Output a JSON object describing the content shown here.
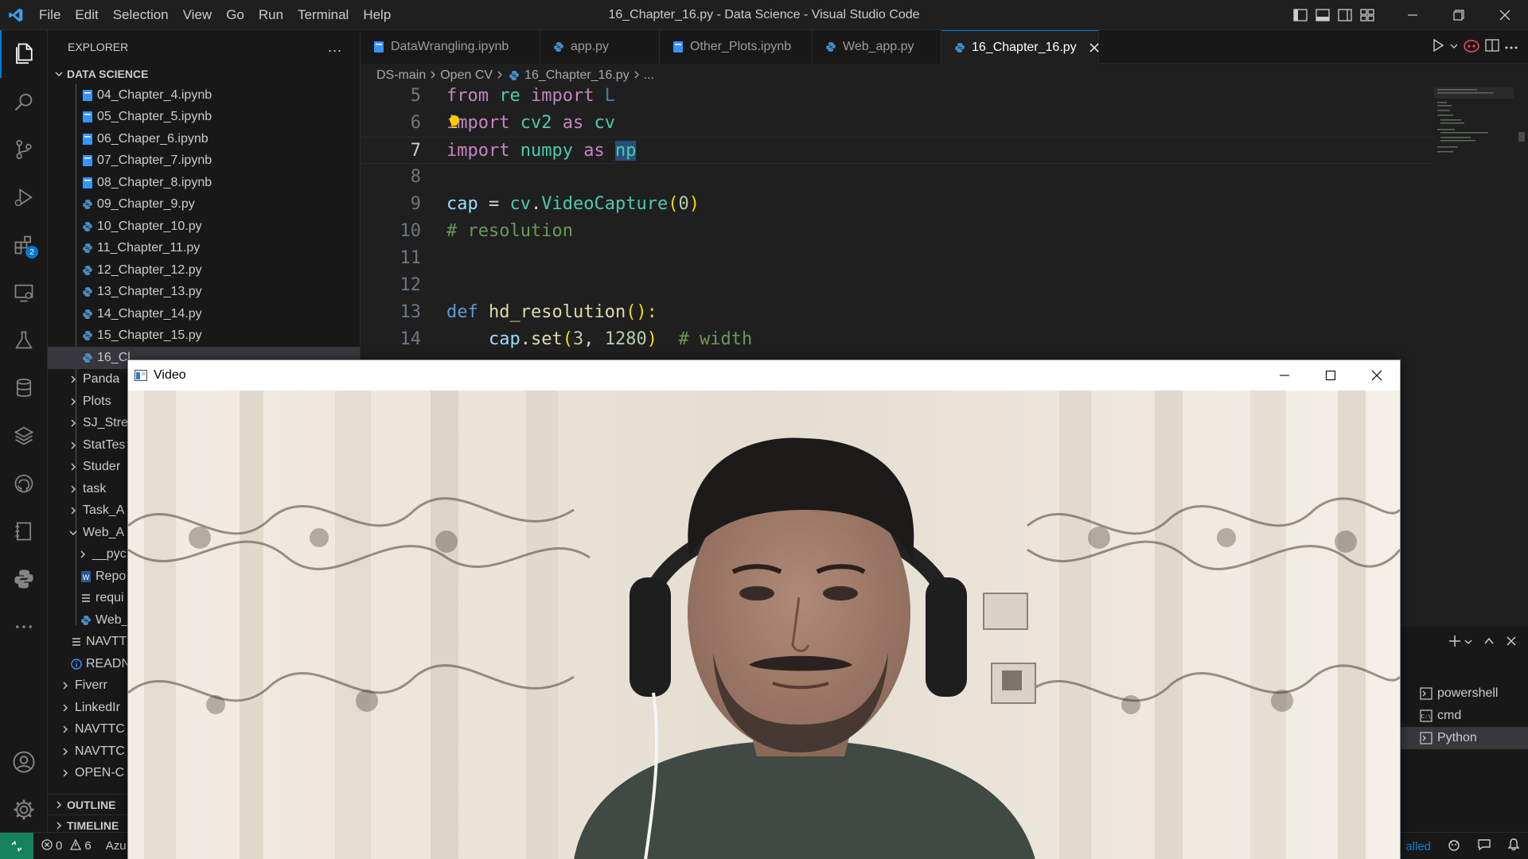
{
  "window": {
    "title": "16_Chapter_16.py - Data Science - Visual Studio Code"
  },
  "menu": [
    "File",
    "Edit",
    "Selection",
    "View",
    "Go",
    "Run",
    "Terminal",
    "Help"
  ],
  "activity_bar": {
    "extensions_badge": "2"
  },
  "sidebar": {
    "title": "EXPLORER",
    "more_label": "...",
    "workspace": "DATA SCIENCE",
    "files": [
      {
        "name": "04_Chapter_4.ipynb",
        "icon": "notebook-icon"
      },
      {
        "name": "05_Chapter_5.ipynb",
        "icon": "notebook-icon"
      },
      {
        "name": "06_Chaper_6.ipynb",
        "icon": "notebook-icon"
      },
      {
        "name": "07_Chapter_7.ipynb",
        "icon": "notebook-icon"
      },
      {
        "name": "08_Chapter_8.ipynb",
        "icon": "notebook-icon"
      },
      {
        "name": "09_Chapter_9.py",
        "icon": "python-icon"
      },
      {
        "name": "10_Chapter_10.py",
        "icon": "python-icon"
      },
      {
        "name": "11_Chapter_11.py",
        "icon": "python-icon"
      },
      {
        "name": "12_Chapter_12.py",
        "icon": "python-icon"
      },
      {
        "name": "13_Chapter_13.py",
        "icon": "python-icon"
      },
      {
        "name": "14_Chapter_14.py",
        "icon": "python-icon"
      },
      {
        "name": "15_Chapter_15.py",
        "icon": "python-icon"
      },
      {
        "name": "16_Cl",
        "icon": "python-icon"
      }
    ],
    "folders_visible": [
      {
        "name": "Panda",
        "depth": 1
      },
      {
        "name": "Plots",
        "depth": 1
      },
      {
        "name": "SJ_Stre",
        "depth": 1
      },
      {
        "name": "StatTes",
        "depth": 1
      },
      {
        "name": "Studer",
        "depth": 1
      },
      {
        "name": "task",
        "depth": 1
      },
      {
        "name": "Task_A",
        "depth": 1
      },
      {
        "name": "Web_A",
        "depth": 1,
        "expanded": true
      },
      {
        "name": "__pyc",
        "depth": 2
      },
      {
        "name": "Repo",
        "depth": 2,
        "file": true,
        "icon": "word-doc-icon"
      },
      {
        "name": "requi",
        "depth": 2,
        "file": true,
        "icon": "lines-icon"
      },
      {
        "name": "Web_",
        "depth": 2,
        "file": true,
        "icon": "python-icon"
      },
      {
        "name": "NAVTT",
        "depth": 1,
        "file": true,
        "icon": "lines-icon"
      },
      {
        "name": "READN",
        "depth": 1,
        "file": true,
        "icon": "info-icon"
      },
      {
        "name": "Fiverr",
        "depth": 0
      },
      {
        "name": "LinkedIr",
        "depth": 0
      },
      {
        "name": "NAVTTC",
        "depth": 0
      },
      {
        "name": "NAVTTC",
        "depth": 0
      },
      {
        "name": "OPEN-C",
        "depth": 0
      }
    ],
    "outline_label": "OUTLINE",
    "timeline_label": "TIMELINE"
  },
  "tabs": [
    {
      "label": "DataWrangling.ipynb",
      "icon": "notebook-icon"
    },
    {
      "label": "app.py",
      "icon": "python-icon"
    },
    {
      "label": "Other_Plots.ipynb",
      "icon": "notebook-icon"
    },
    {
      "label": "Web_app.py",
      "icon": "python-icon"
    },
    {
      "label": "16_Chapter_16.py",
      "icon": "python-icon",
      "active": true
    }
  ],
  "breadcrumbs": [
    "DS-main",
    "Open CV",
    "16_Chapter_16.py",
    "..."
  ],
  "editor": {
    "lines": [
      {
        "n": "5",
        "tokens": [
          [
            "from",
            "kw"
          ],
          [
            " ",
            "pl"
          ],
          [
            "re",
            "mod"
          ],
          [
            " ",
            "pl"
          ],
          [
            "import",
            "kw"
          ],
          [
            " ",
            "pl"
          ],
          [
            "L",
            "dim"
          ]
        ]
      },
      {
        "n": "6",
        "tokens": [
          [
            "import",
            "kw"
          ],
          [
            " ",
            "pl"
          ],
          [
            "cv2",
            "mod"
          ],
          [
            " ",
            "pl"
          ],
          [
            "as",
            "kw"
          ],
          [
            " ",
            "pl"
          ],
          [
            "cv",
            "mod"
          ]
        ]
      },
      {
        "n": "7",
        "tokens": [
          [
            "import",
            "kw"
          ],
          [
            " ",
            "pl"
          ],
          [
            "numpy",
            "mod"
          ],
          [
            " ",
            "pl"
          ],
          [
            "as",
            "kw"
          ],
          [
            " ",
            "pl"
          ],
          [
            "np",
            "mod sel"
          ]
        ],
        "current": true
      },
      {
        "n": "8",
        "tokens": []
      },
      {
        "n": "9",
        "tokens": [
          [
            "cap",
            "var"
          ],
          [
            " = ",
            "pl"
          ],
          [
            "cv",
            "mod"
          ],
          [
            ".",
            "pl"
          ],
          [
            "VideoCapture",
            "mod"
          ],
          [
            "(",
            "paren"
          ],
          [
            "0",
            "num"
          ],
          [
            ")",
            "paren"
          ]
        ]
      },
      {
        "n": "10",
        "tokens": [
          [
            "# resolution",
            "cm"
          ]
        ]
      },
      {
        "n": "11",
        "tokens": []
      },
      {
        "n": "12",
        "tokens": []
      },
      {
        "n": "13",
        "tokens": [
          [
            "def",
            "kwd"
          ],
          [
            " ",
            "pl"
          ],
          [
            "hd_resolution",
            "fn"
          ],
          [
            "():",
            "paren"
          ]
        ]
      },
      {
        "n": "14",
        "tokens": [
          [
            "    ",
            "pl"
          ],
          [
            "cap",
            "var"
          ],
          [
            ".",
            "pl"
          ],
          [
            "set",
            "fn"
          ],
          [
            "(",
            "paren"
          ],
          [
            "3",
            "num"
          ],
          [
            ", ",
            "pl"
          ],
          [
            "1280",
            "num"
          ],
          [
            ")",
            "paren"
          ],
          [
            "  ",
            "pl"
          ],
          [
            "# width",
            "cm"
          ]
        ]
      }
    ]
  },
  "terminal": {
    "list": [
      {
        "label": "powershell",
        "icon": "terminal-icon"
      },
      {
        "label": "cmd",
        "icon": "cmd-icon"
      },
      {
        "label": "Python",
        "icon": "terminal-icon",
        "active": true
      }
    ]
  },
  "statusbar": {
    "errors": "0",
    "warnings": "6",
    "azure_label": "Azu",
    "right_text": "alled"
  },
  "video_window": {
    "title": "Video"
  },
  "colors": {
    "accent": "#0078d4",
    "remote": "#16825d",
    "python_blue": "#4a90c8",
    "notebook_blue": "#3794ff"
  }
}
